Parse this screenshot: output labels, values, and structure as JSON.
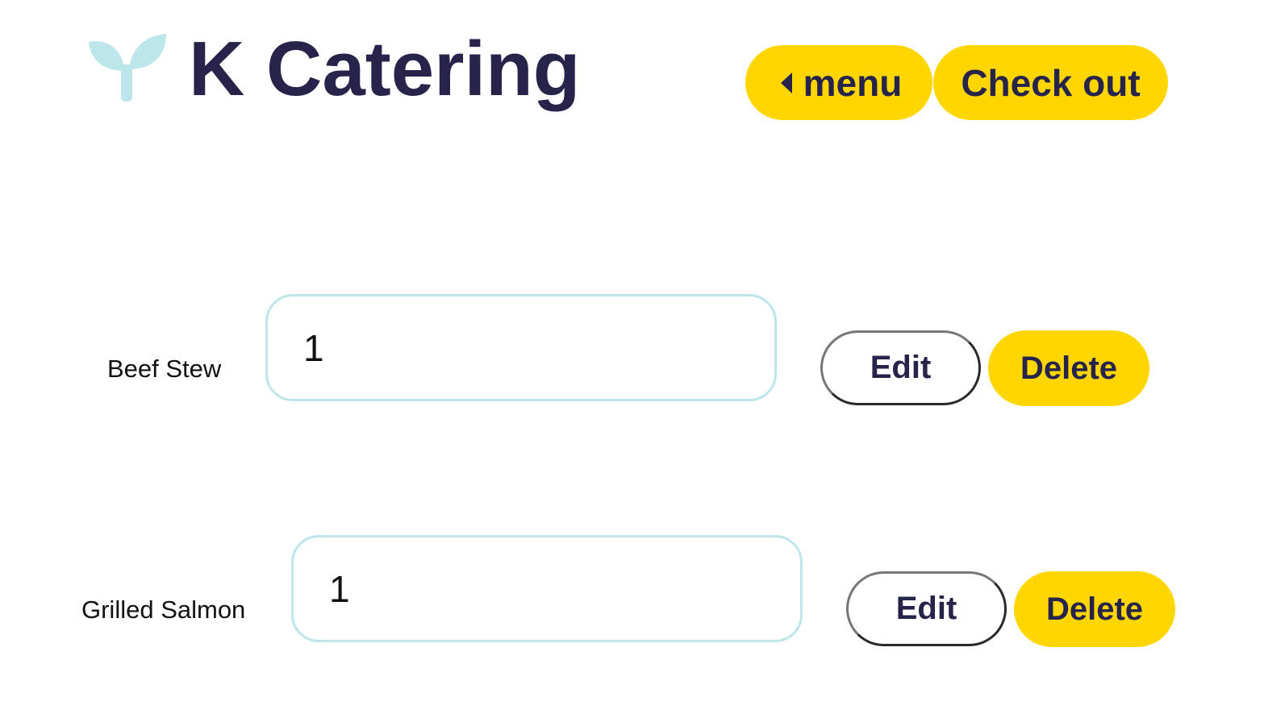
{
  "header": {
    "logo_icon": "sprout-icon",
    "logo_color": "#bde6ea",
    "title": "K Catering",
    "menu_label": "menu",
    "menu_icon": "caret-left-icon",
    "checkout_label": "Check out"
  },
  "colors": {
    "accent": "#ffd600",
    "text_dark": "#26244a",
    "input_border": "#bde5ea"
  },
  "cart": {
    "items": [
      {
        "name": "Beef Stew",
        "quantity": "1",
        "edit_label": "Edit",
        "delete_label": "Delete"
      },
      {
        "name": "Grilled Salmon",
        "quantity": "1",
        "edit_label": "Edit",
        "delete_label": "Delete"
      }
    ]
  }
}
